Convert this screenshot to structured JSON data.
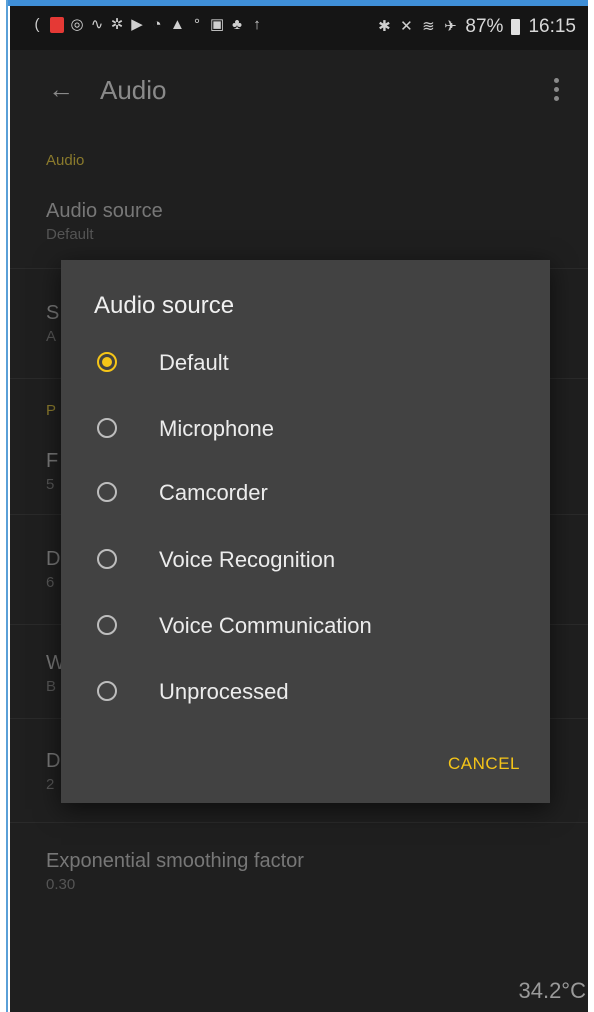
{
  "status_bar": {
    "battery": "87%",
    "time": "16:15"
  },
  "app_bar": {
    "title": "Audio"
  },
  "settings": {
    "section_audio": "Audio",
    "audio_source": {
      "title": "Audio source",
      "value": "Default"
    },
    "smoothing": {
      "title": "Exponential smoothing factor",
      "value": "0.30"
    },
    "partial_rows": [
      {
        "title": "S",
        "value": "A"
      },
      {
        "header": "P"
      },
      {
        "title": "F",
        "value": "5"
      },
      {
        "title": "D",
        "value": "6"
      },
      {
        "title": "W",
        "value": "B"
      },
      {
        "title": "D",
        "value": "2"
      }
    ]
  },
  "dialog": {
    "title": "Audio source",
    "selected": "Default",
    "options": [
      "Default",
      "Microphone",
      "Camcorder",
      "Voice Recognition",
      "Voice Communication",
      "Unprocessed"
    ],
    "cancel_label": "CANCEL"
  },
  "overlay": {
    "temperature": "34.2°C"
  },
  "colors": {
    "accent": "#f5c518",
    "dialog_bg": "#424242",
    "screen_bg": "#1f1f1f"
  }
}
